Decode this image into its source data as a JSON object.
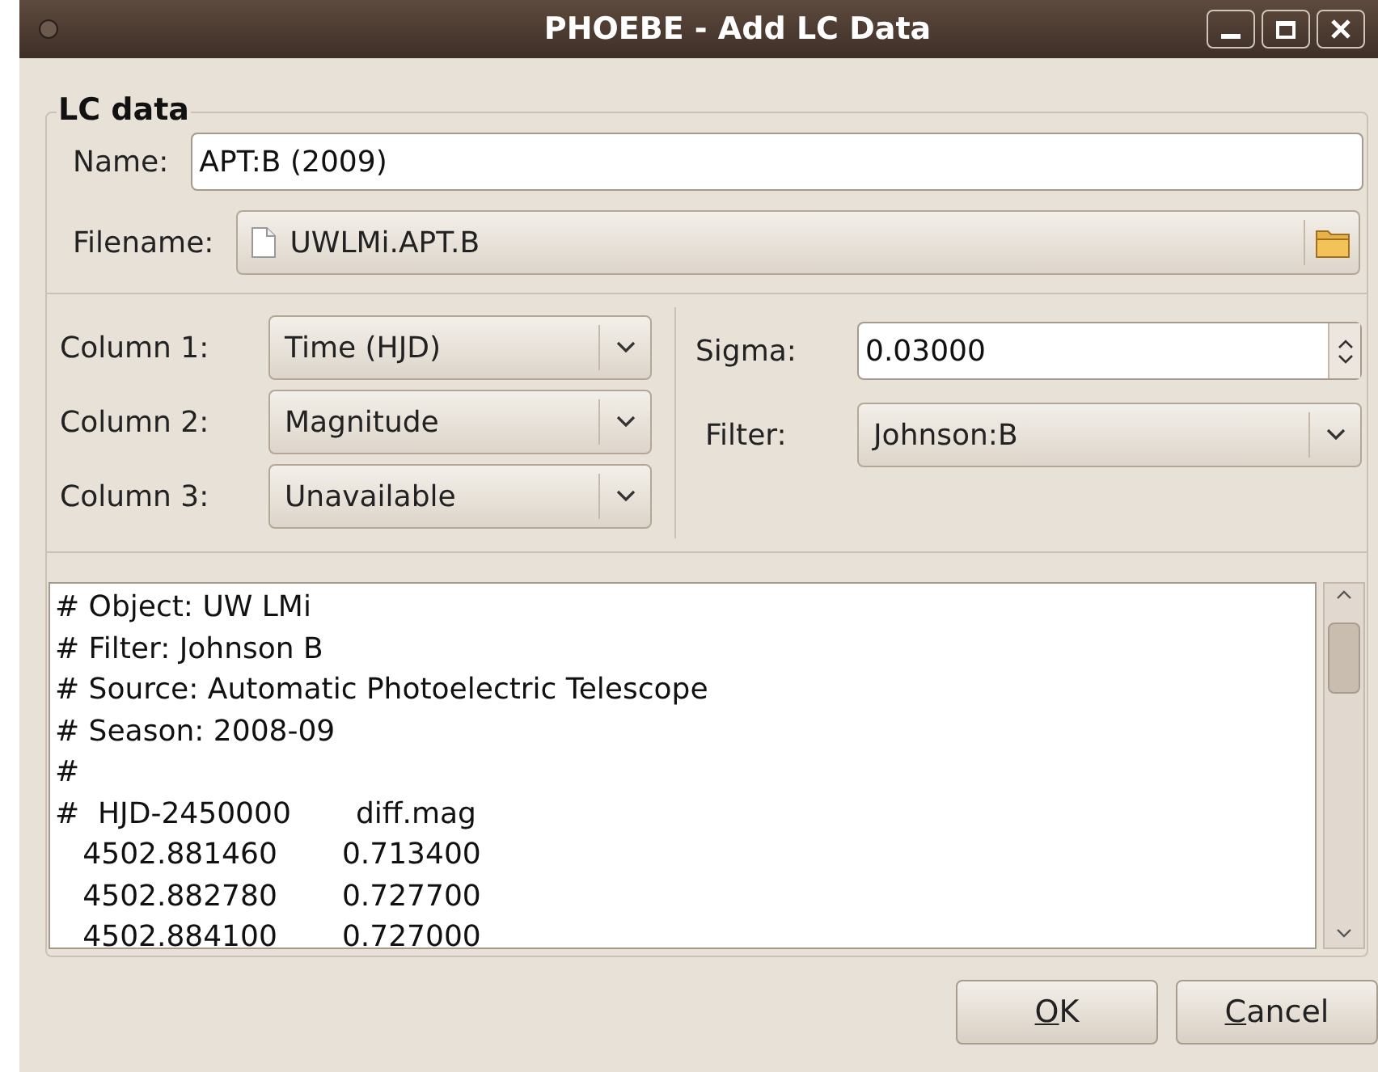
{
  "window": {
    "title": "PHOEBE - Add LC Data"
  },
  "group": {
    "title": "LC data"
  },
  "name": {
    "label": "Name:",
    "value": "APT:B (2009)"
  },
  "filename": {
    "label": "Filename:",
    "value": "UWLMi.APT.B"
  },
  "columns": [
    {
      "label": "Column 1:",
      "value": "Time (HJD)"
    },
    {
      "label": "Column 2:",
      "value": "Magnitude"
    },
    {
      "label": "Column 3:",
      "value": "Unavailable"
    }
  ],
  "sigma": {
    "label": "Sigma:",
    "value": "0.03000"
  },
  "filter": {
    "label": "Filter:",
    "value": "Johnson:B"
  },
  "file_preview": [
    "# Object: UW LMi",
    "# Filter: Johnson B",
    "# Source: Automatic Photoelectric Telescope",
    "# Season: 2008-09",
    "#",
    "#  HJD-2450000       diff.mag",
    "   4502.881460       0.713400",
    "   4502.882780       0.727700",
    "   4502.884100       0.727000"
  ],
  "buttons": [
    {
      "accel": "O",
      "rest": "K"
    },
    {
      "accel": "C",
      "rest": "ancel"
    }
  ]
}
